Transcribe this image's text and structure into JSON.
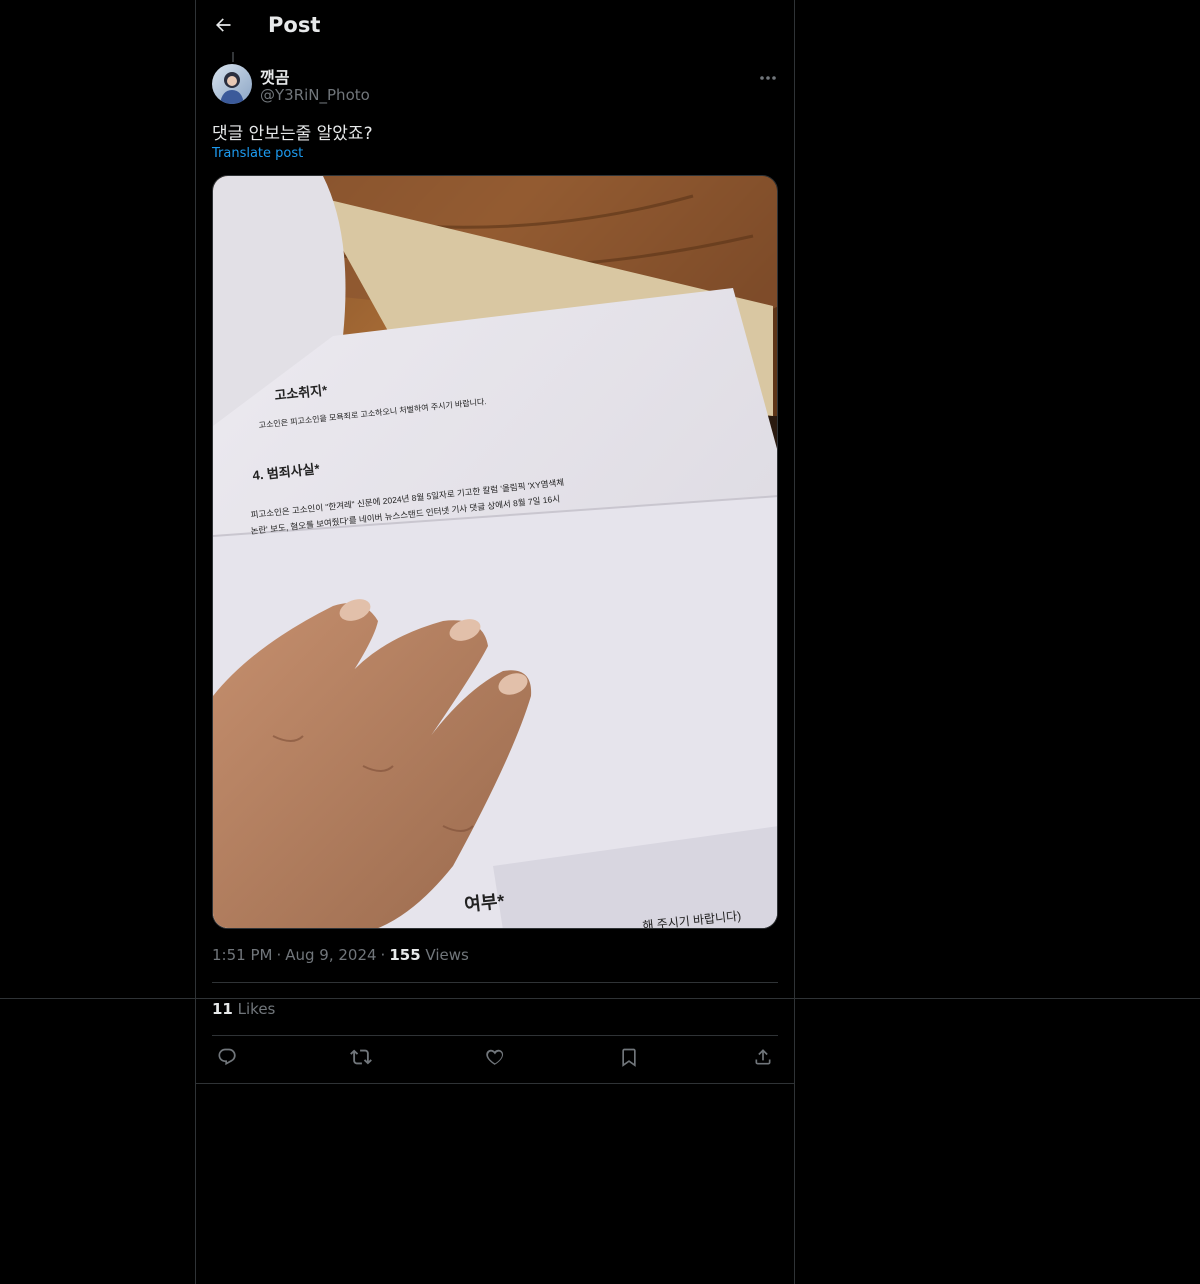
{
  "header": {
    "title": "Post",
    "back_icon": "arrow-left-icon"
  },
  "author": {
    "display_name": "깻곰",
    "handle": "@Y3RiN_Photo",
    "avatar": "avatar-photo"
  },
  "post": {
    "text": "댓글 안보는줄 알았죠?",
    "translate_label": "Translate post"
  },
  "media": {
    "doc_heading_1": "고소취지*",
    "doc_line_1": "고소인은 피고소인을 모욕죄로 고소하오니 처벌하여 주시기 바랍니다.",
    "doc_heading_2": "4. 범죄사실*",
    "doc_line_2": "피고소인은 고소인이 \"한겨레\" 신문에 2024년 8월 5일자로 기고한 칼럼 '올림픽 'XY염색체",
    "doc_line_3": "논란' 보도, 혐오를 보여줬다'를 네이버 뉴스스탠드 인터넷 기사 댓글 상에서 8월 7일 16시",
    "doc_heading_3": "여부*",
    "doc_line_4": "해 주시기 바랍니다)"
  },
  "meta": {
    "time": "1:51 PM",
    "date": "Aug 9, 2024",
    "views_count": "155",
    "views_label": "Views"
  },
  "stats": {
    "likes_count": "11",
    "likes_label": "Likes"
  },
  "actions": [
    "reply-icon",
    "retweet-icon",
    "like-icon",
    "bookmark-icon",
    "share-icon"
  ],
  "colors": {
    "background": "#000000",
    "text": "#e7e9ea",
    "muted": "#71767b",
    "accent": "#1d9bf0",
    "border": "#2f3336"
  }
}
